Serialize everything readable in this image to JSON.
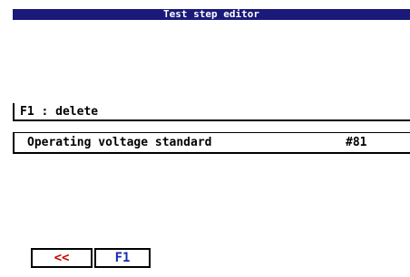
{
  "title": "Test step editor",
  "hint": "F1 : delete",
  "step": {
    "name": "Operating voltage standard",
    "number": "#81"
  },
  "buttons": {
    "back_label": "<<",
    "f1_label": "F1"
  },
  "colors": {
    "title_bg": "#1a1a7a",
    "back": "#cc0000",
    "f1": "#1a2ab0"
  }
}
